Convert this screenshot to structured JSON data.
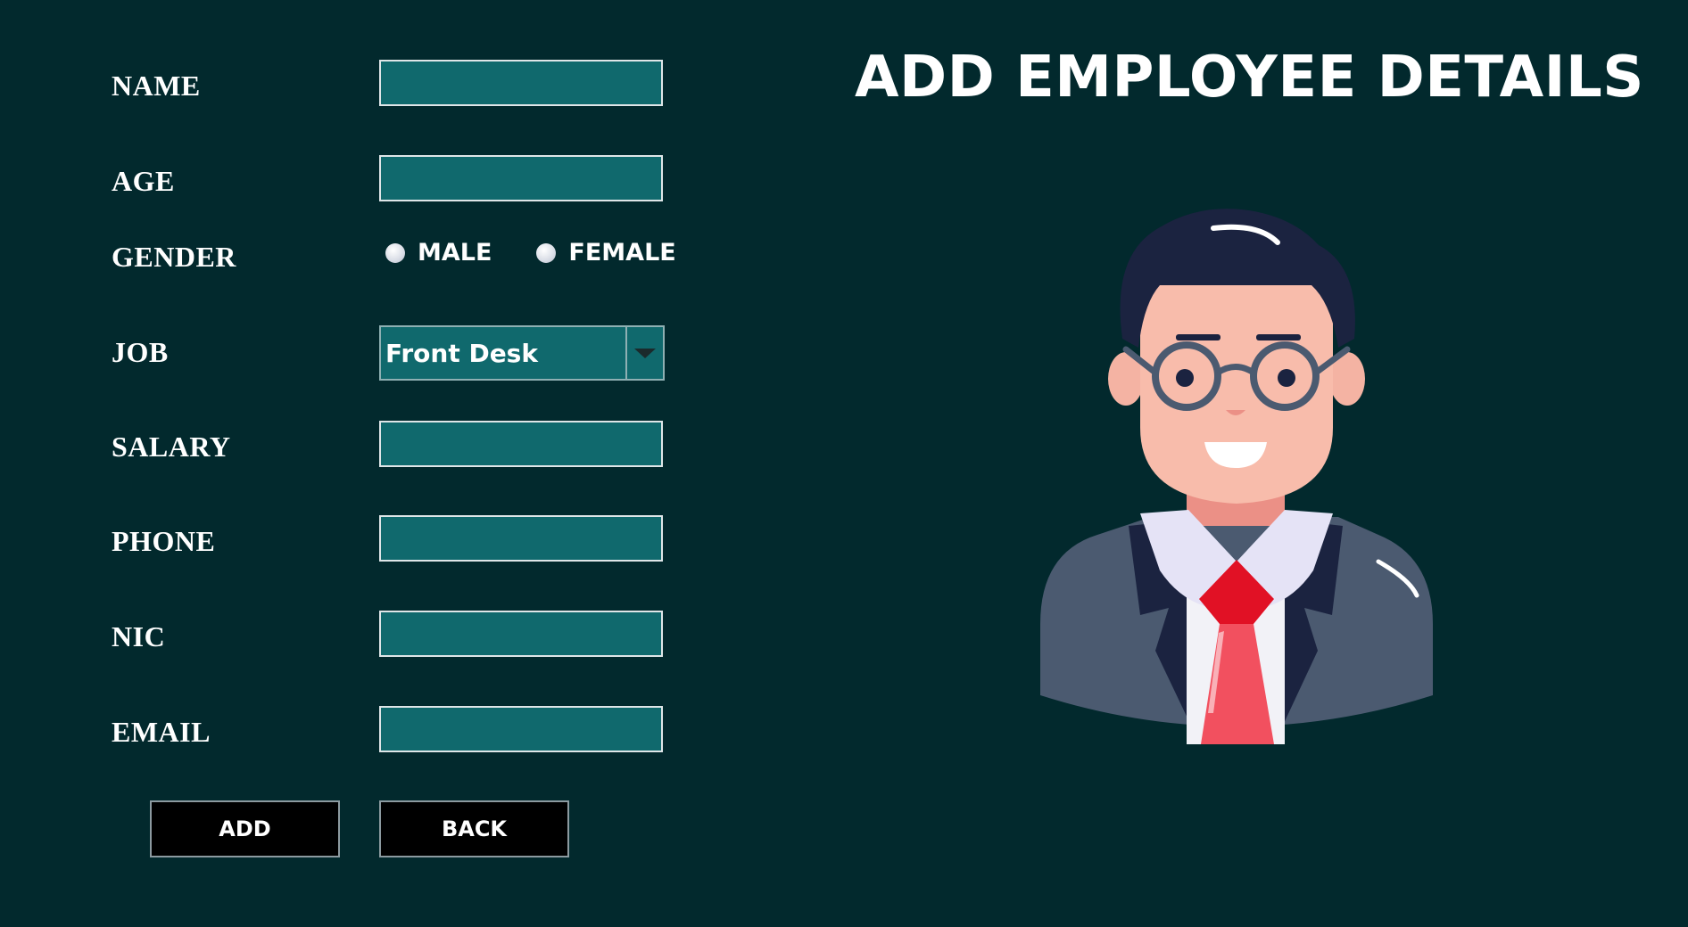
{
  "page": {
    "title": "ADD EMPLOYEE DETAILS"
  },
  "form": {
    "name_label": "NAME",
    "age_label": "AGE",
    "gender_label": "GENDER",
    "gender_options": [
      "MALE",
      "FEMALE"
    ],
    "job_label": "JOB",
    "job_selected": "Front Desk",
    "salary_label": "SALARY",
    "phone_label": "PHONE",
    "nic_label": "NIC",
    "email_label": "EMAIL",
    "name_value": "",
    "age_value": "",
    "salary_value": "",
    "phone_value": "",
    "nic_value": "",
    "email_value": ""
  },
  "buttons": {
    "add_label": "ADD",
    "back_label": "BACK"
  },
  "colors": {
    "background": "#02292d",
    "field_fill": "#10696d",
    "button_fill": "#000000"
  },
  "icons": {
    "avatar": "businessman-avatar-illustration",
    "dropdown": "chevron-down-icon",
    "radio": "radio-button-icon"
  }
}
